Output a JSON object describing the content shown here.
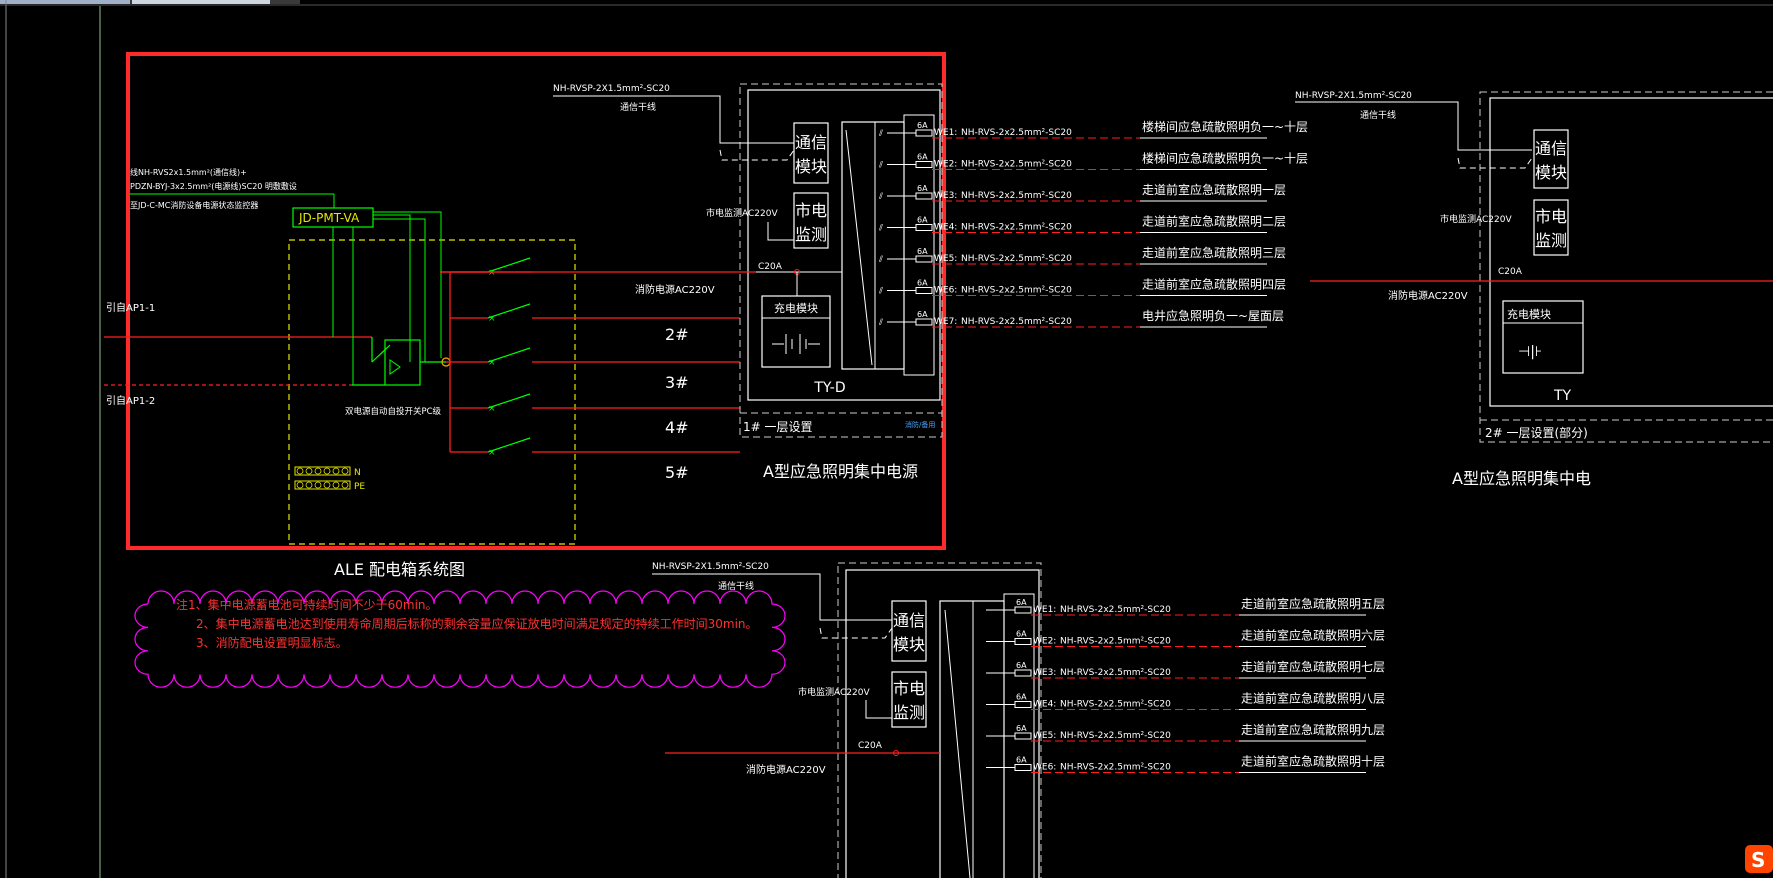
{
  "drawing": {
    "main_box_title": "ALE 配电箱系统图",
    "panel_code": "JD-PMT-VA",
    "feed_labels": [
      "引自AP1-1",
      "引自AP1-2"
    ],
    "left_cable_notes": [
      "线NH-RVS2x1.5mm²(通信线)+",
      "PDZN-BYJ-3x2.5mm²(电源线)SC20 明敷敷设",
      "至JD-C-MC消防设备电源状态监控器"
    ],
    "ats_label": "双电源自动自投开关PC级",
    "bus_labels": [
      "N",
      "PE"
    ],
    "fire_power_label": "消防电源AC220V",
    "city_power_label": "市电监测AC220V",
    "outgoing_numbers": [
      "2#",
      "3#",
      "4#",
      "5#"
    ],
    "cable_top": "NH-RVSP-2X1.5mm²-SC20",
    "comm_trunk": "通信干线",
    "module_comm": "通信模块",
    "module_city": "市电监测",
    "module_charge": "充电模块",
    "breaker": "C20A",
    "fuse_rating": "6A",
    "unit_code": "TY-D",
    "unit_location_1": "1# 一层设置",
    "unit_small_tag": "消防/备用",
    "unit_caption": "A型应急照明集中电源",
    "circuits_1": [
      {
        "id": "WE1:",
        "cable": "NH-RVS-2x2.5mm²-SC20",
        "desc": "楼梯间应急疏散照明负一~十层"
      },
      {
        "id": "WE2:",
        "cable": "NH-RVS-2x2.5mm²-SC20",
        "desc": "楼梯间应急疏散照明负一~十层"
      },
      {
        "id": "WE3:",
        "cable": "NH-RVS-2x2.5mm²-SC20",
        "desc": "走道前室应急疏散照明一层"
      },
      {
        "id": "WE4:",
        "cable": "NH-RVS-2x2.5mm²-SC20",
        "desc": "走道前室应急疏散照明二层"
      },
      {
        "id": "WE5:",
        "cable": "NH-RVS-2x2.5mm²-SC20",
        "desc": "走道前室应急疏散照明三层"
      },
      {
        "id": "WE6:",
        "cable": "NH-RVS-2x2.5mm²-SC20",
        "desc": "走道前室应急疏散照明四层"
      },
      {
        "id": "WE7:",
        "cable": "NH-RVS-2x2.5mm²-SC20",
        "desc": "电井应急照明负一~屋面层"
      }
    ],
    "circuits_3": [
      {
        "id": "WE1:",
        "cable": "NH-RVS-2x2.5mm²-SC20",
        "desc": "走道前室应急疏散照明五层"
      },
      {
        "id": "WE2:",
        "cable": "NH-RVS-2x2.5mm²-SC20",
        "desc": "走道前室应急疏散照明六层"
      },
      {
        "id": "WE3:",
        "cable": "NH-RVS-2x2.5mm²-SC20",
        "desc": "走道前室应急疏散照明七层"
      },
      {
        "id": "WE4:",
        "cable": "NH-RVS-2x2.5mm²-SC20",
        "desc": "走道前室应急疏散照明八层"
      },
      {
        "id": "WE5:",
        "cable": "NH-RVS-2x2.5mm²-SC20",
        "desc": "走道前室应急疏散照明九层"
      },
      {
        "id": "WE6:",
        "cable": "NH-RVS-2x2.5mm²-SC20",
        "desc": "走道前室应急疏散照明十层"
      }
    ],
    "unit2_location": "2# 一层设置(部分)",
    "unit2_caption": "A型应急照明集中电",
    "unit2_code": "TY",
    "notes": [
      "注1、集中电源蓄电池可持续时间不少于60min。",
      "2、集中电源蓄电池达到使用寿命周期后标称的剩余容量应保证放电时间满足规定的持续工作时间30min。",
      "3、消防配电设置明显标志。"
    ],
    "watermark": "S"
  },
  "colors": {
    "background": "#000000",
    "selection": "#ff2a2a",
    "wire_white": "#ffffff",
    "wire_red": "#ff2020",
    "wire_green": "#00ff00",
    "dashed_yellow": "#e6e600",
    "cloud_magenta": "#ff00ff",
    "note_red": "#ff3030",
    "watermark": "#ff4400"
  }
}
